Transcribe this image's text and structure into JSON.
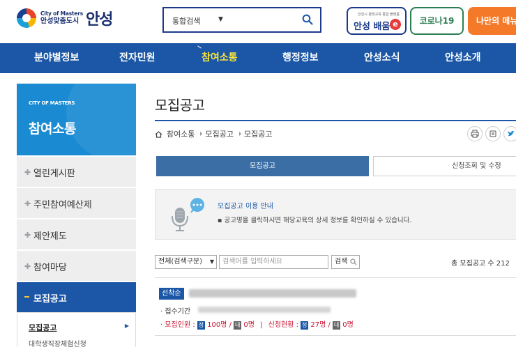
{
  "header": {
    "logo": {
      "en": "City of Masters",
      "ko_small": "안성맞춤도시",
      "ko_big": "안성"
    },
    "search": {
      "select_label": "통합검색"
    },
    "baeum": {
      "small": "안성시 평생교육 통합 플랫폼",
      "label": "안성 배움",
      "mark": "e"
    },
    "corona_label": "코로나19",
    "orange_label": "나만의 메뉴"
  },
  "gnb": {
    "items": [
      "분야별정보",
      "전자민원",
      "참여소통",
      "행정정보",
      "안성소식",
      "안성소개"
    ],
    "active": "참여소통"
  },
  "sidebar": {
    "en": "CITY OF MASTERS",
    "title": "참여소통",
    "items": [
      "열린게시판",
      "주민참여예산제",
      "제안제도",
      "참여마당",
      "모집공고"
    ],
    "active_item": "모집공고",
    "sub_items": [
      "모집공고",
      "대학생직장체험신청"
    ]
  },
  "content": {
    "title": "모집공고",
    "breadcrumb": [
      "참여소통",
      "모집공고",
      "모집공고"
    ],
    "tabs": [
      "모집공고",
      "신청조회 및 수정"
    ],
    "info": {
      "title": "모집공고 이용 안내",
      "desc": "▪ 공고명을 클릭하시면 해당교육의 상세 정보를 확인하실 수 있습니다."
    },
    "filter": {
      "select": "전체(검색구분)",
      "placeholder": "검색어를 입력하세요",
      "button": "검색",
      "total": "총 모집공고 수 212"
    },
    "item": {
      "status": "선착순",
      "period_label": "· 접수기간",
      "recruit_label": "· 모집인원 :",
      "recruit_chip1": "정",
      "recruit_val1": "100명",
      "recruit_chip2": "대",
      "recruit_val2": "0명",
      "apply_label": "신청현황 :",
      "apply_chip1": "정",
      "apply_val1": "27명",
      "apply_chip2": "대",
      "apply_val2": "0명",
      "slash": "/",
      "divider": "|"
    }
  },
  "colors": {
    "primary": "#1b57a6",
    "sky": "#1a8bd2",
    "accent_yellow": "#f8e63b",
    "orange": "#f47a2a",
    "green": "#2a7f52",
    "red": "#c8102e"
  }
}
